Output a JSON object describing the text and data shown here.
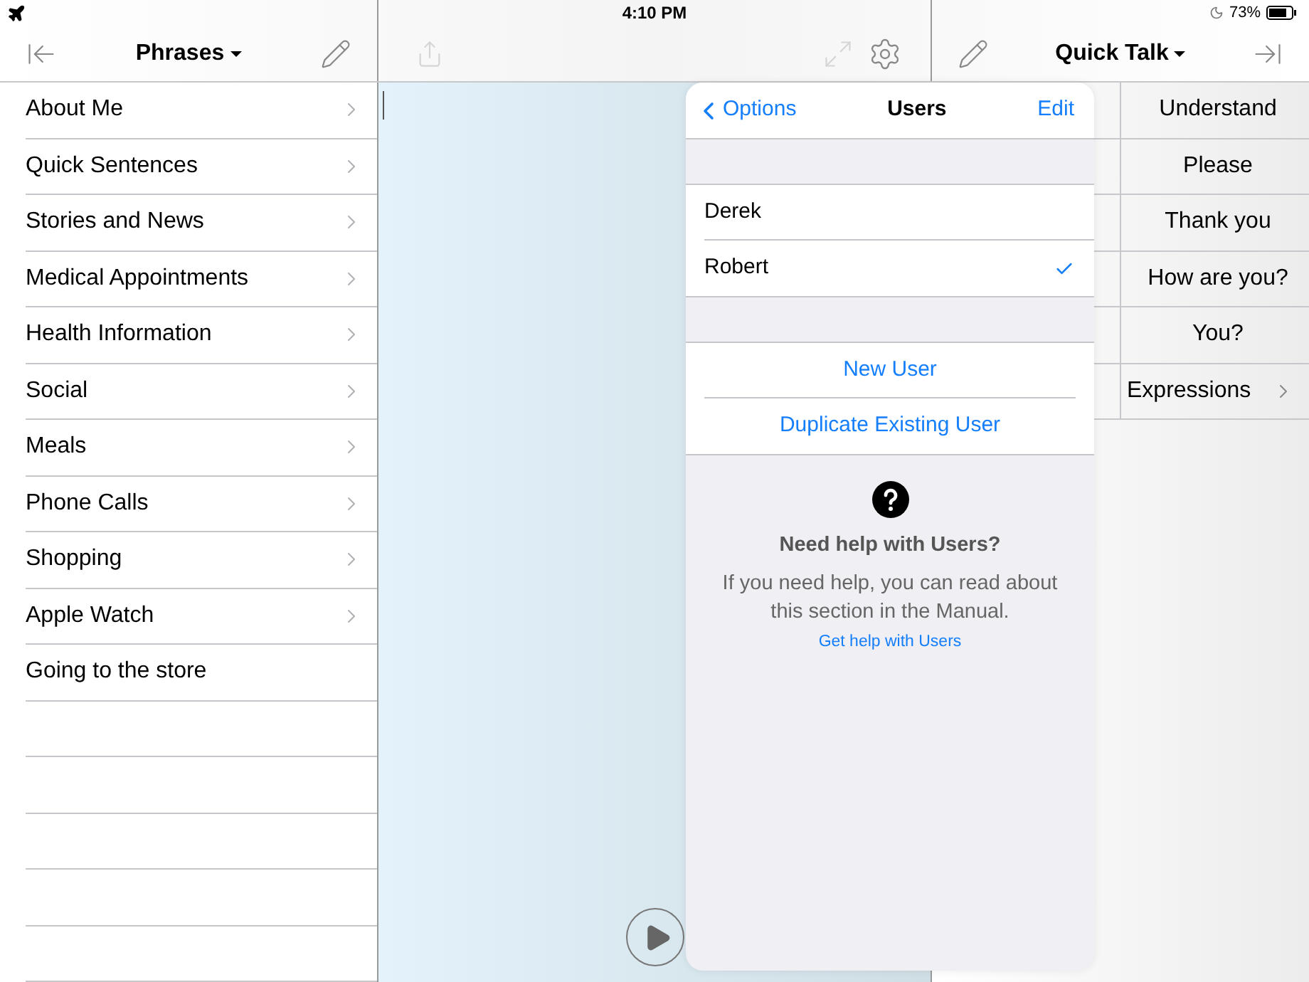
{
  "status_bar": {
    "time": "4:10 PM",
    "battery": "73%"
  },
  "left_panel": {
    "title": "Phrases",
    "items": [
      {
        "label": "About Me",
        "has_children": true
      },
      {
        "label": "Quick Sentences",
        "has_children": true
      },
      {
        "label": "Stories and News",
        "has_children": true
      },
      {
        "label": "Medical Appointments",
        "has_children": true
      },
      {
        "label": "Health Information",
        "has_children": true
      },
      {
        "label": "Social",
        "has_children": true
      },
      {
        "label": "Meals",
        "has_children": true
      },
      {
        "label": "Phone Calls",
        "has_children": true
      },
      {
        "label": "Shopping",
        "has_children": true
      },
      {
        "label": "Apple Watch",
        "has_children": true
      },
      {
        "label": "Going to the store",
        "has_children": false
      }
    ]
  },
  "right_panel": {
    "title": "Quick Talk",
    "items": [
      {
        "label": "Understand",
        "has_children": false
      },
      {
        "label": "Please",
        "has_children": false
      },
      {
        "label": "Thank you",
        "has_children": false
      },
      {
        "label": "How are you?",
        "has_children": false
      },
      {
        "label": "You?",
        "has_children": false
      },
      {
        "label": "Expressions",
        "has_children": true
      }
    ]
  },
  "popover": {
    "back": "Options",
    "title": "Users",
    "action": "Edit",
    "users": [
      {
        "name": "Derek",
        "selected": false
      },
      {
        "name": "Robert",
        "selected": true
      }
    ],
    "buttons": [
      "New User",
      "Duplicate Existing User"
    ],
    "help": {
      "title": "Need help with Users?",
      "text": "If you need help, you can read about this section in the Manual.",
      "link": "Get help with Users"
    }
  }
}
